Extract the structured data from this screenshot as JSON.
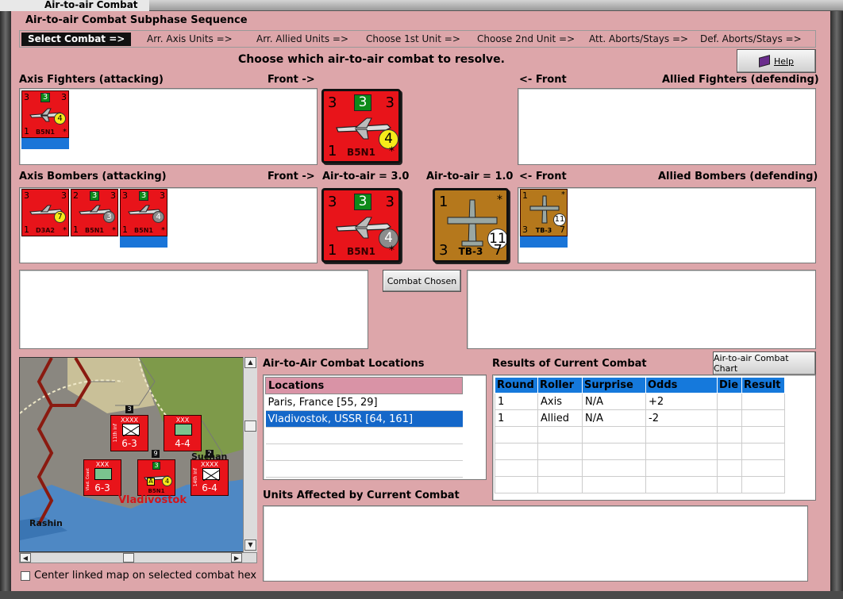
{
  "window": {
    "title": "Air-to-air Combat"
  },
  "sequence": {
    "title": "Air-to-air Combat Subphase Sequence",
    "steps": [
      "Select Combat =>",
      "Arr. Axis Units =>",
      "Arr. Allied Units =>",
      "Choose 1st Unit =>",
      "Choose 2nd Unit =>",
      "Att. Aborts/Stays =>",
      "Def. Aborts/Stays =>"
    ]
  },
  "instruction": "Choose which air-to-air combat to resolve.",
  "help_label": "Help",
  "labels": {
    "axis_fighters": "Axis Fighters (attacking)",
    "allied_fighters": "Allied Fighters (defending)",
    "axis_bombers": "Axis Bombers (attacking)",
    "allied_bombers": "Allied Bombers (defending)",
    "front_right": "Front ->",
    "front_left": "<- Front",
    "axis_a2a": "Air-to-air = 3.0",
    "allied_a2a": "Air-to-air = 1.0"
  },
  "combat_chosen_label": "Combat Chosen",
  "a2a_chart_label": "Air-to-air Combat Chart",
  "counters": {
    "axis_fighter": {
      "name": "B5N1",
      "tl": "3",
      "top": "3",
      "tr": "3",
      "bl": "1",
      "br": "*",
      "circle": "4"
    },
    "axis_bombers": [
      {
        "name": "D3A2",
        "tl": "3",
        "tr": "3",
        "bl": "1",
        "br": "*",
        "circle": "7"
      },
      {
        "name": "B5N1",
        "tl": "2",
        "top": "3",
        "tr": "3",
        "bl": "1",
        "br": "*",
        "circle": "3"
      },
      {
        "name": "B5N1",
        "tl": "3",
        "top": "3",
        "tr": "3",
        "bl": "1",
        "br": "*",
        "circle": "4"
      }
    ],
    "axis_bomber_big": {
      "name": "B5N1",
      "tl": "3",
      "top": "3",
      "tr": "3",
      "bl": "1",
      "br": "*",
      "circle": "4"
    },
    "allied_bomber": {
      "name": "TB-3",
      "tl": "1",
      "tr": "*",
      "bl": "3",
      "br": "7",
      "circle": "11"
    }
  },
  "locations": {
    "title": "Air-to-Air Combat Locations",
    "header": "Locations",
    "rows": [
      "Paris, France [55, 29]",
      "Vladivostok, USSR [64, 161]"
    ],
    "selected_index": 1
  },
  "results": {
    "title": "Results of Current Combat",
    "columns": [
      "Round",
      "Roller",
      "Surprise",
      "Odds",
      "Die",
      "Result"
    ],
    "rows": [
      [
        "1",
        "Axis",
        "N/A",
        "+2",
        "",
        ""
      ],
      [
        "1",
        "Allied",
        "N/A",
        "-2",
        "",
        ""
      ]
    ]
  },
  "affected_title": "Units Affected by Current Combat",
  "center_map_label": "Center linked map on selected combat hex",
  "map": {
    "city": "Vladivostok",
    "town1": "Rashin",
    "town2": "Suchan",
    "units": [
      {
        "size": "XXXX",
        "side": "11th Inf",
        "value": "6-3"
      },
      {
        "size": "XXX",
        "value": "4-4"
      },
      {
        "size": "XXX",
        "side": "Vlad. Coast",
        "value": "6-3"
      },
      {
        "size": "XXXX",
        "side": "14th Inf",
        "value": "6-4"
      }
    ],
    "stack_counts": [
      "3",
      "9",
      "2"
    ],
    "air_unit": {
      "name": "B5N1",
      "top": "3",
      "circle": "4",
      "badge": "A"
    }
  }
}
